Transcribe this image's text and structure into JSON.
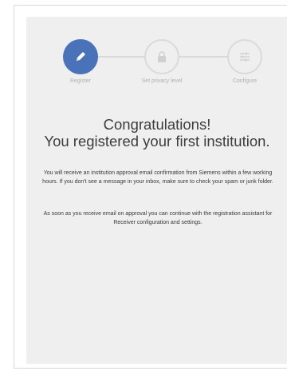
{
  "stepper": {
    "steps": [
      {
        "label": "Register",
        "icon": "pencil-icon",
        "state": "active"
      },
      {
        "label": "Set privacy level",
        "icon": "lock-icon",
        "state": "inactive"
      },
      {
        "label": "Configure",
        "icon": "sliders-icon",
        "state": "inactive"
      }
    ]
  },
  "heading": {
    "line1": "Congratulations!",
    "line2": "You registered your first institution."
  },
  "message": {
    "paragraph1": "You will receive an institution approval email confirmation from Siemens within a few working hours. If you don't see a message in your inbox, make sure to check your spam or junk folder.",
    "paragraph2": "As soon as you receive email on approval you can continue with the registration assistant for Receiver configuration and settings."
  },
  "colors": {
    "accent": "#4a72b8",
    "panel_background": "#efefef",
    "inactive_step": "#dadada",
    "text": "#3a3a3a"
  }
}
